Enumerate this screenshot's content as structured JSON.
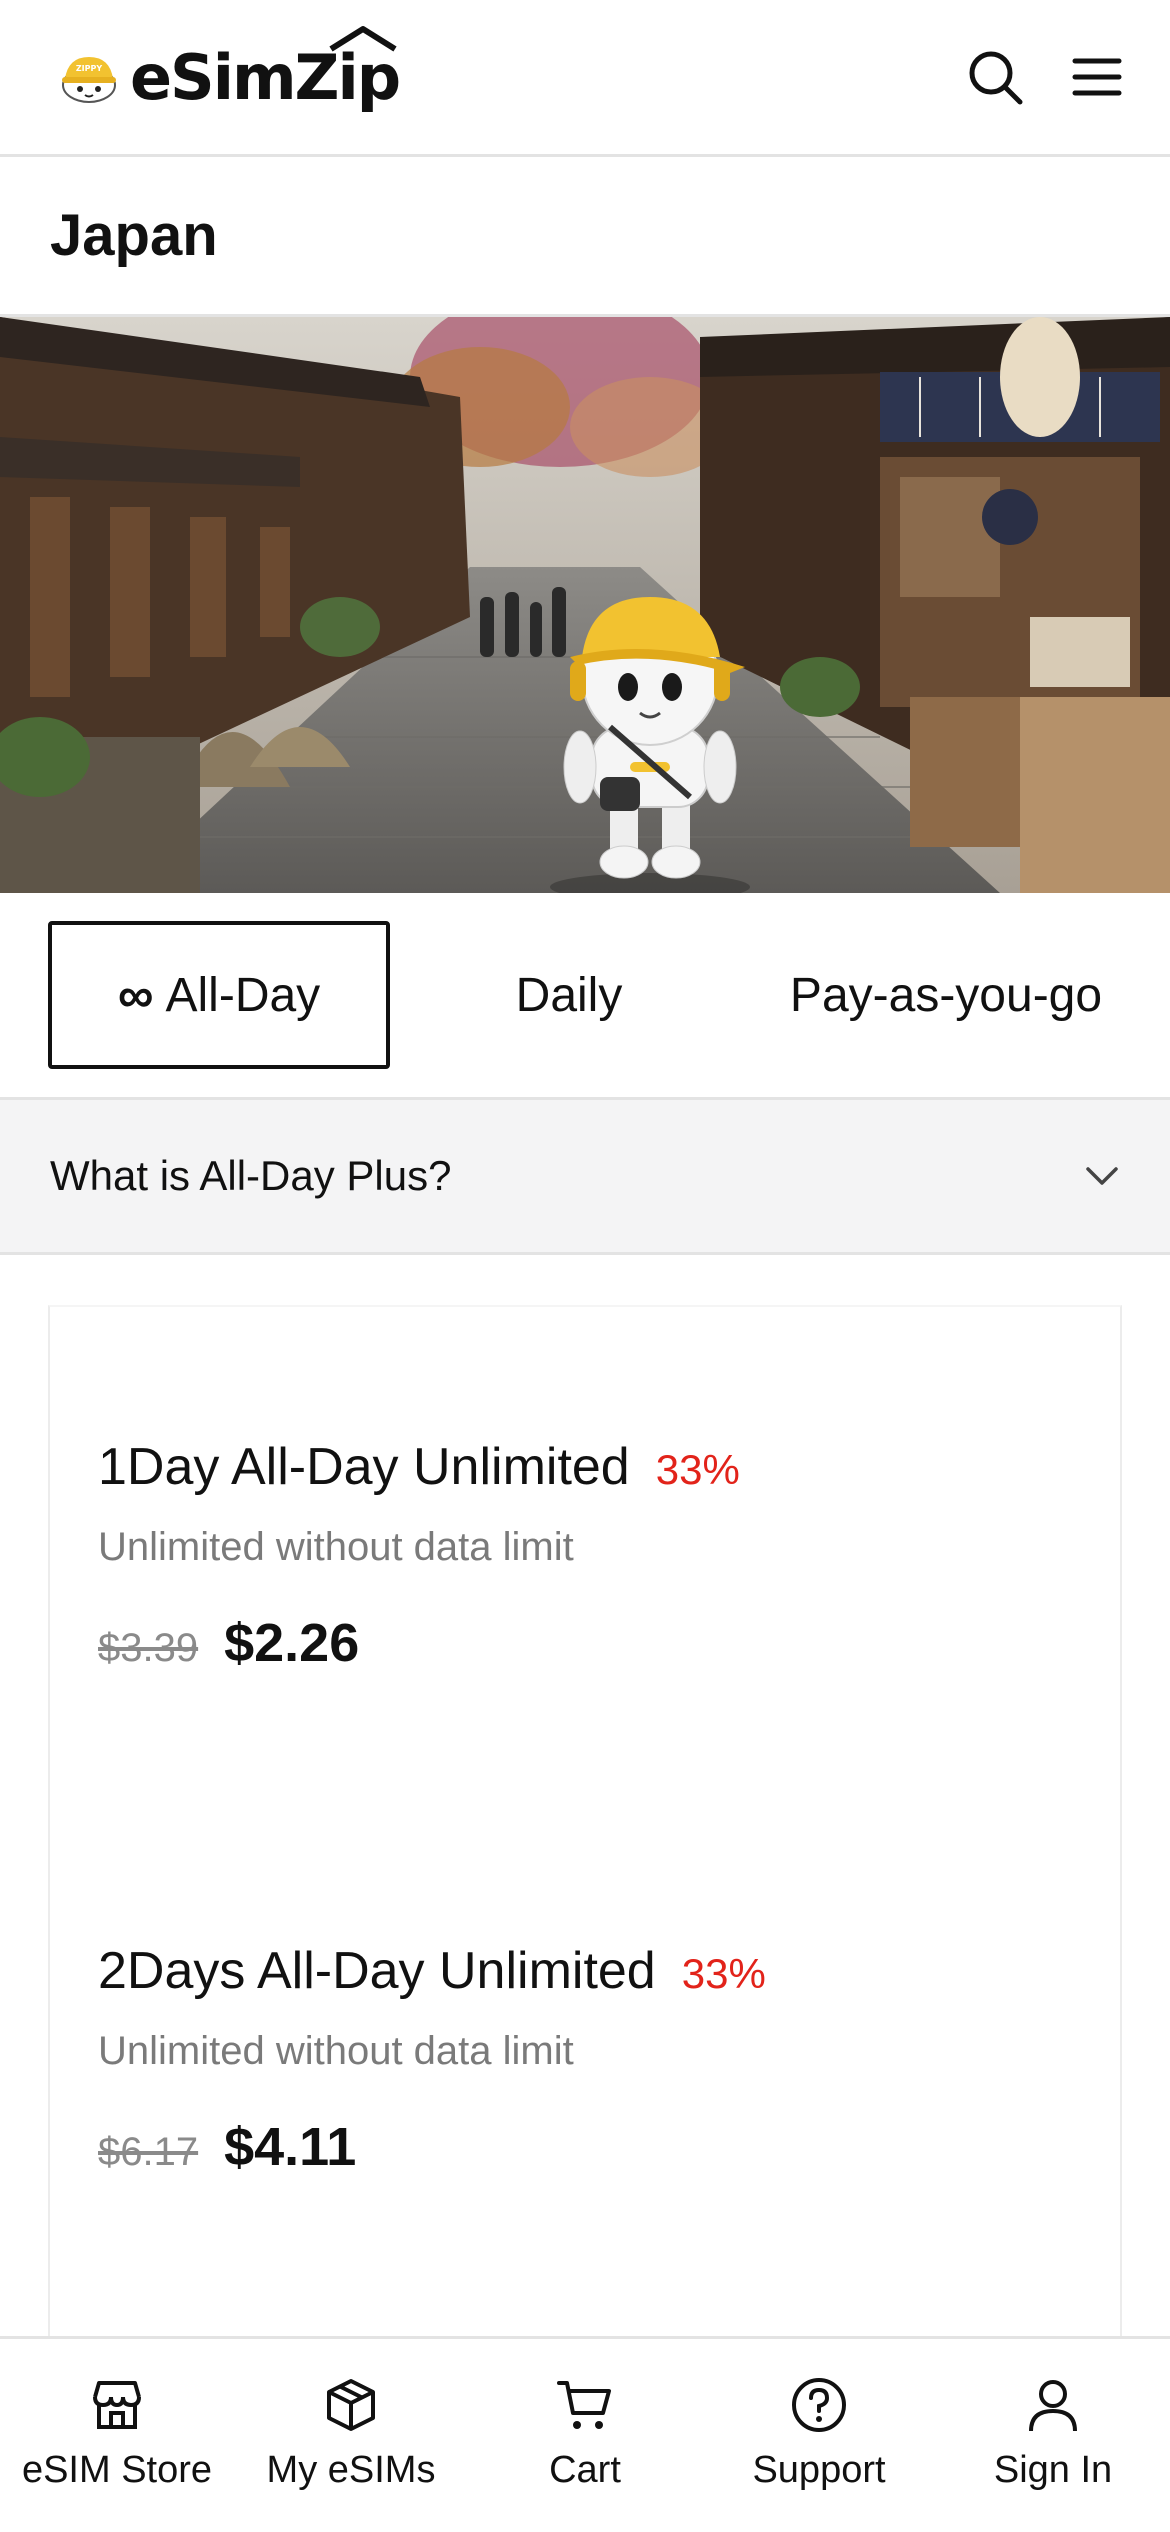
{
  "brand": {
    "name": "eSimZip",
    "mascot_text": "ZIPPY"
  },
  "header": {
    "search_icon": "search-icon",
    "menu_icon": "hamburger-menu-icon"
  },
  "country": {
    "title": "Japan"
  },
  "tabs": [
    {
      "label": "All-Day",
      "icon": "∞",
      "active": true
    },
    {
      "label": "Daily",
      "active": false
    },
    {
      "label": "Pay-as-you-go",
      "active": false
    }
  ],
  "accordion": {
    "label": "What is All-Day Plus?"
  },
  "plans": [
    {
      "title": "1Day All-Day Unlimited",
      "discount": "33%",
      "description": "Unlimited without data limit",
      "old_price": "$3.39",
      "price": "$2.26"
    },
    {
      "title": "2Days All-Day Unlimited",
      "discount": "33%",
      "description": "Unlimited without data limit",
      "old_price": "$6.17",
      "price": "$4.11"
    }
  ],
  "bottom_nav": [
    {
      "label": "eSIM Store",
      "icon": "store-icon"
    },
    {
      "label": "My eSIMs",
      "icon": "box-icon"
    },
    {
      "label": "Cart",
      "icon": "cart-icon"
    },
    {
      "label": "Support",
      "icon": "help-icon"
    },
    {
      "label": "Sign In",
      "icon": "user-icon"
    }
  ],
  "colors": {
    "discount": "#e2231a",
    "accent": "#f2c230",
    "text": "#111111"
  }
}
